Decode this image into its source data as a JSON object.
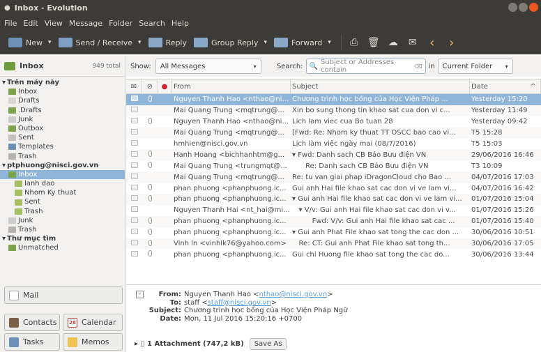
{
  "window": {
    "title": "Inbox - Evolution"
  },
  "menu": [
    "File",
    "Edit",
    "View",
    "Message",
    "Folder",
    "Search",
    "Help"
  ],
  "toolbar": {
    "new_label": "New",
    "send_receive_label": "Send / Receive",
    "reply_label": "Reply",
    "group_reply_label": "Group Reply",
    "forward_label": "Forward"
  },
  "sidebar": {
    "header_label": "Inbox",
    "header_count": "949 total",
    "tree": [
      {
        "label": "Trên máy này",
        "kind": "account",
        "indent": 0
      },
      {
        "label": "Inbox",
        "kind": "folder",
        "indent": 1,
        "color": "#7da44d"
      },
      {
        "label": "Drafts",
        "kind": "folder",
        "indent": 1,
        "color": "#d9d6cf"
      },
      {
        "label": ".Drafts",
        "kind": "folder",
        "indent": 1,
        "color": "#7da44d"
      },
      {
        "label": "Junk",
        "kind": "folder",
        "indent": 1,
        "color": "#cccccc"
      },
      {
        "label": "Outbox",
        "kind": "folder",
        "indent": 1,
        "color": "#7da44d"
      },
      {
        "label": "Sent",
        "kind": "folder",
        "indent": 1,
        "color": "#c7c2b9"
      },
      {
        "label": "Templates",
        "kind": "folder",
        "indent": 1,
        "color": "#6e8fb6"
      },
      {
        "label": "Trash",
        "kind": "folder",
        "indent": 1,
        "color": "#b5b3ae"
      },
      {
        "label": "ptphuong@nisci.gov.vn",
        "kind": "account",
        "indent": 0
      },
      {
        "label": "Inbox",
        "kind": "folder",
        "indent": 1,
        "color": "#7da44d",
        "selected": true
      },
      {
        "label": "lanh dao",
        "kind": "folder",
        "indent": 2,
        "color": "#a5be62"
      },
      {
        "label": "Nhom Ky thuat",
        "kind": "folder",
        "indent": 2,
        "color": "#a5be62"
      },
      {
        "label": "Sent",
        "kind": "folder",
        "indent": 2,
        "color": "#a5be62"
      },
      {
        "label": "Trash",
        "kind": "folder",
        "indent": 2,
        "color": "#a5be62"
      },
      {
        "label": "Junk",
        "kind": "folder",
        "indent": 1,
        "color": "#cccccc"
      },
      {
        "label": "Trash",
        "kind": "folder",
        "indent": 1,
        "color": "#b5b3ae"
      },
      {
        "label": "Thư mục tìm",
        "kind": "account",
        "indent": 0
      },
      {
        "label": "Unmatched",
        "kind": "folder",
        "indent": 1,
        "color": "#7da44d"
      }
    ],
    "switcher": {
      "mail": "Mail",
      "contacts": "Contacts",
      "calendar": "Calendar",
      "calendar_day": "28",
      "tasks": "Tasks",
      "memos": "Memos"
    }
  },
  "searchbar": {
    "show_label": "Show:",
    "show_value": "All Messages",
    "search_label": "Search:",
    "search_placeholder": "Subject or Addresses contain",
    "in_label": "in",
    "in_value": "Current Folder"
  },
  "list": {
    "columns": {
      "from": "From",
      "subject": "Subject",
      "date": "Date"
    },
    "rows": [
      {
        "from": "Nguyen Thanh Hao <nthao@ni...",
        "subject": "Chương trình học bổng của Học Viện Pháp ...",
        "date": "Yesterday 15:20",
        "attach": true,
        "selected": true
      },
      {
        "from": "Mai Quang Trung <mqtrung@...",
        "subject": "Xin bo sung thong tin khao sat cua don vi c...",
        "date": "Yesterday 11:49",
        "attach": false
      },
      {
        "from": "Nguyen Thanh Hao <nthao@ni...",
        "subject": "Lich lam viec cua Bo tuan 28",
        "date": "Yesterday 09:42",
        "attach": true
      },
      {
        "from": "Mai Quang Trung <mqtrung@...",
        "subject": "[Fwd: Re: Nhom ky thuat TT OSCC bao cao vi...",
        "date": "T5 15:28",
        "attach": false
      },
      {
        "from": "hmhien@nisci.gov.vn",
        "subject": "Lịch làm việc ngày mai (08/7/2016)",
        "date": "T5 15:03",
        "attach": false
      },
      {
        "from": "Hanh Hoang <bichhanhtm@g...",
        "subject": "▾ Fwd: Danh sach CB Bảo Bưu điện VN",
        "date": "29/06/2016 16:46",
        "attach": true
      },
      {
        "from": "Mai Quang Trung <trungmqt@...",
        "subject": "      Re: Danh sach CB Bảo Bưu điện VN",
        "date": "T3 10:09",
        "attach": true
      },
      {
        "from": "Mai Quang Trung <mqtrung@...",
        "subject": "Re: tu van giai phap iDragonCloud cho Bao ...",
        "date": "04/07/2016 17:03",
        "attach": false
      },
      {
        "from": "phan phuong <phanphuong.ic...",
        "subject": "Gui anh Hai file khao sat cac don vi ve lam vi...",
        "date": "04/07/2016 16:42",
        "attach": true
      },
      {
        "from": "phan phuong <phanphuong.ic...",
        "subject": "▾ Gui anh Hai file khao sat cac don vi ve lam vi...",
        "date": "01/07/2016 15:04",
        "attach": true
      },
      {
        "from": "Nguyen Thanh Hai <nt_hai@mi...",
        "subject": "   ▾ V/v: Gui anh Hai file khao sat cac don vi v...",
        "date": "01/07/2016 15:26",
        "attach": false
      },
      {
        "from": "phan phuong <phanphuong.ic...",
        "subject": "         Fwd: V/v: Gui anh Hai file khao sat cac ...",
        "date": "01/07/2016 15:40",
        "attach": true
      },
      {
        "from": "phan phuong <phanphuong.ic...",
        "subject": "▾ Gui anh Phat File khao sat tong the cac don ...",
        "date": "30/06/2016 10:51",
        "attach": true
      },
      {
        "from": "Vinh ln <vinhlk76@yahoo.com>",
        "subject": "   Re: CT: Gui anh Phat File khao sat tong th...",
        "date": "30/06/2016 17:05",
        "attach": true
      },
      {
        "from": "phan phuong <phanphuong.ic...",
        "subject": "Gui chi Huong file khao sat tong the cac do...",
        "date": "30/06/2016 13:44",
        "attach": true
      }
    ]
  },
  "preview": {
    "from_label": "From:",
    "from_name": "Nguyen Thanh Hao <",
    "from_email": "nthao@nisci.gov.vn",
    "from_end": ">",
    "to_label": "To:",
    "to_name": "staff <",
    "to_email": "staff@nisci.gov.vn",
    "to_end": ">",
    "subject_label": "Subject:",
    "subject_value": "Chương trình học bổng của Học Viện Pháp Ngữ",
    "date_label": "Date:",
    "date_value": "Mon, 11 Jul 2016 15:20:16 +0700",
    "attachment_label": "1 Attachment (747,2 kB)",
    "save_as_label": "Save As"
  }
}
